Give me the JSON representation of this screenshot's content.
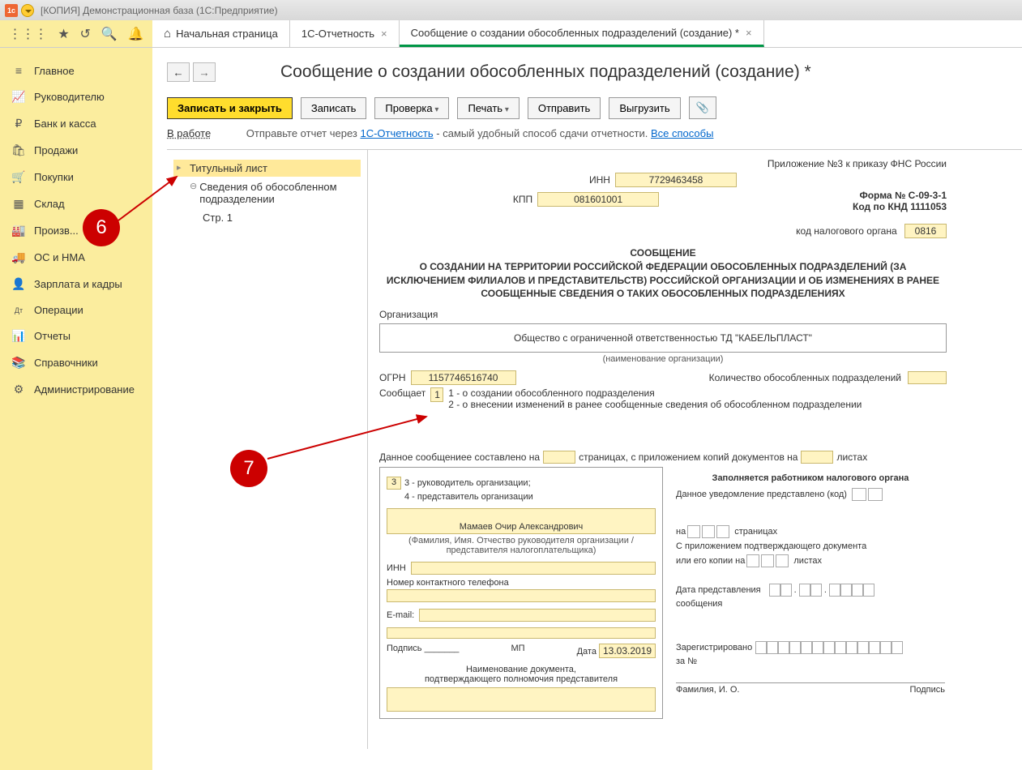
{
  "titlebar": {
    "text": "[КОПИЯ] Демонстрационная база  (1С:Предприятие)"
  },
  "tabs": {
    "home": "Начальная страница",
    "t1": "1С-Отчетность",
    "t2": "Сообщение о создании обособленных подразделений  (создание) *"
  },
  "sidebar": [
    {
      "icon": "≡",
      "label": "Главное"
    },
    {
      "icon": "📈",
      "label": "Руководителю"
    },
    {
      "icon": "₽",
      "label": "Банк и касса"
    },
    {
      "icon": "🛍",
      "label": "Продажи"
    },
    {
      "icon": "🛒",
      "label": "Покупки"
    },
    {
      "icon": "▦",
      "label": "Склад"
    },
    {
      "icon": "🏭",
      "label": "Произв..."
    },
    {
      "icon": "🚚",
      "label": "ОС и НМА"
    },
    {
      "icon": "👤",
      "label": "Зарплата и кадры"
    },
    {
      "icon": "Дт",
      "label": "Операции"
    },
    {
      "icon": "📊",
      "label": "Отчеты"
    },
    {
      "icon": "📚",
      "label": "Справочники"
    },
    {
      "icon": "⚙",
      "label": "Администрирование"
    }
  ],
  "page": {
    "title": "Сообщение о создании обособленных подразделений  (создание) *"
  },
  "buttons": {
    "save_close": "Записать и закрыть",
    "save": "Записать",
    "check": "Проверка",
    "print": "Печать",
    "send": "Отправить",
    "export": "Выгрузить"
  },
  "status": {
    "label": "В работе",
    "pre": "Отправьте отчет через ",
    "link1": "1С-Отчетность",
    "mid": " - самый удобный способ сдачи отчетности. ",
    "link2": "Все способы"
  },
  "tree": {
    "title": "Титульный лист",
    "sub": "Сведения об обособленном подразделении",
    "page": "Стр. 1"
  },
  "form": {
    "app": "Приложение №3 к приказу ФНС России",
    "inn_l": "ИНН",
    "inn": "7729463458",
    "kpp_l": "КПП",
    "kpp": "081601001",
    "form_no": "Форма № С-09-3-1",
    "knd": "Код по КНД 1111053",
    "tax_l": "код налогового органа",
    "tax": "0816",
    "title": "СООБЩЕНИЕ\nО СОЗДАНИИ НА ТЕРРИТОРИИ РОССИЙСКОЙ ФЕДЕРАЦИИ ОБОСОБЛЕННЫХ ПОДРАЗДЕЛЕНИЙ (ЗА ИСКЛЮЧЕНИЕМ ФИЛИАЛОВ И ПРЕДСТАВИТЕЛЬСТВ) РОССИЙСКОЙ ОРГАНИЗАЦИИ И ОБ ИЗМЕНЕНИЯХ В РАНЕЕ СООБЩЕННЫЕ СВЕДЕНИЯ О ТАКИХ ОБОСОБЛЕННЫХ ПОДРАЗДЕЛЕНИЯХ",
    "org_l": "Организация",
    "org": "Общество с ограниченной ответственностью ТД \"КАБЕЛЬПЛАСТ\"",
    "org_hint": "(наименование организации)",
    "ogrn_l": "ОГРН",
    "ogrn": "1157746516740",
    "cnt_l": "Количество обособленных подразделений",
    "soob_l": "Сообщает",
    "soob": "1",
    "soob1": "1 - о создании обособленного подразделения",
    "soob2": "2 - о внесении изменений в ранее сообщенные сведения об обособленном подразделении",
    "pages1": "Данное сообщениее составлено на",
    "pages2": "страницах, с приложением копий документов на",
    "pages3": "листах",
    "left": {
      "code": "3",
      "l1": "3 - руководитель организации;",
      "l2": "4 - представитель организации",
      "fio": "Мамаев Очир Александрович",
      "fio_hint": "(Фамилия, Имя. Отчество руководителя организации / представителя налогоплательщика)",
      "inn": "ИНН",
      "phone": "Номер контактного телефона",
      "email": "E-mail:",
      "sign": "Подпись",
      "mp": "МП",
      "date_l": "Дата",
      "date": "13.03.2019",
      "doc1": "Наименование документа,",
      "doc2": "подтверждающего полномочия представителя"
    },
    "right": {
      "head": "Заполняется работником налогового органа",
      "l1": "Данное уведомление представлено (код)",
      "l2a": "на",
      "l2b": "страницах",
      "l3": "С приложением подтверждающего документа",
      "l4a": "или его копии на",
      "l4b": "листах",
      "l5": "Дата представления",
      "l5b": "сообщения",
      "l6": "Зарегистрировано",
      "l6b": "за №",
      "fio": "Фамилия, И. О.",
      "sign": "Подпись"
    }
  },
  "anno": {
    "a6": "6",
    "a7": "7"
  }
}
